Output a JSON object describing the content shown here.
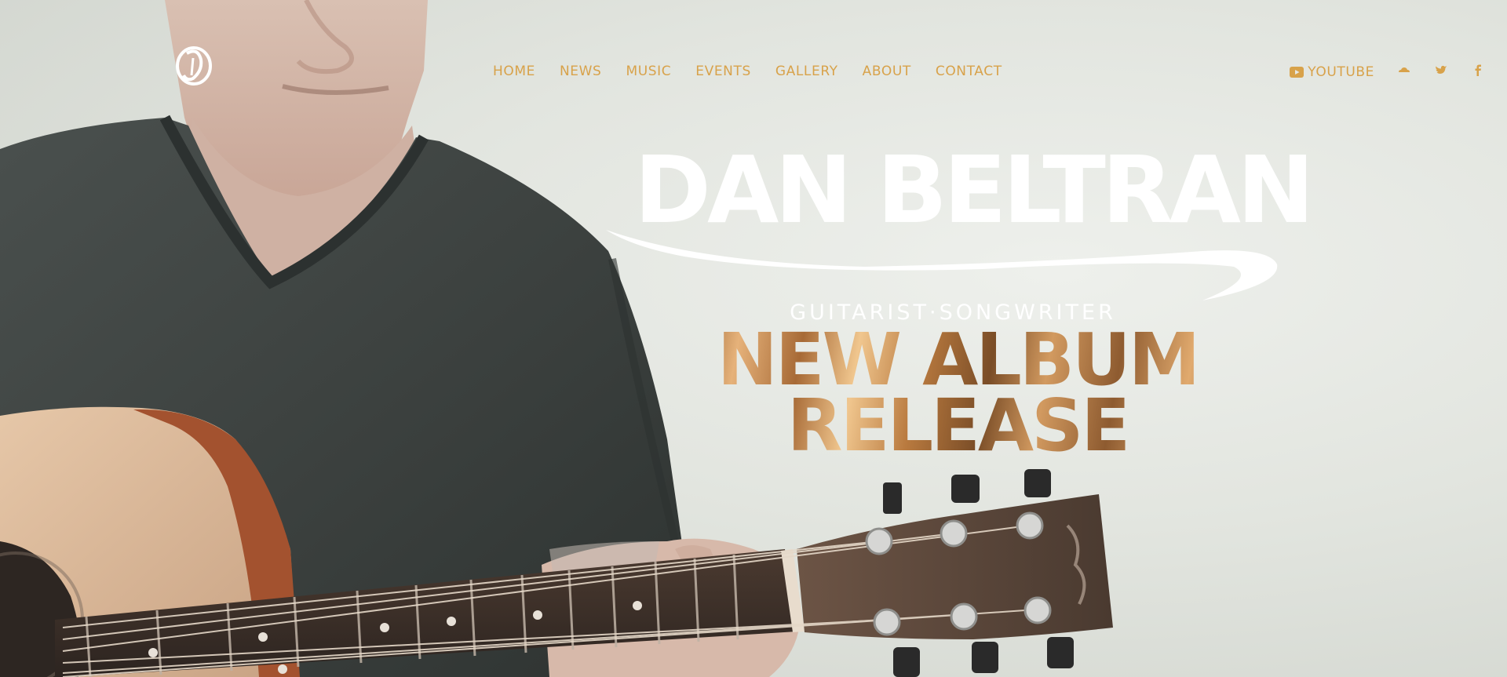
{
  "site": {
    "artist_name": "DAN BELTRAN",
    "tagline": "GUITARIST·SONGWRITER",
    "headline_line1": "NEW ALBUM",
    "headline_line2": "RELEASE"
  },
  "nav": {
    "items": [
      {
        "label": "HOME"
      },
      {
        "label": "NEWS"
      },
      {
        "label": "MUSIC"
      },
      {
        "label": "EVENTS"
      },
      {
        "label": "GALLERY"
      },
      {
        "label": "ABOUT"
      },
      {
        "label": "CONTACT"
      }
    ]
  },
  "social": {
    "youtube_label": "YOUTUBE",
    "icons": [
      "youtube-icon",
      "soundcloud-icon",
      "twitter-icon",
      "facebook-icon"
    ]
  },
  "logo": {
    "icon": "artist-monogram-logo"
  },
  "colors": {
    "nav_text": "#d8a24a",
    "title_text": "#ffffff",
    "background": "#e2e5df",
    "shirt": "#3f4442",
    "guitar_wood": "#a3522f"
  }
}
